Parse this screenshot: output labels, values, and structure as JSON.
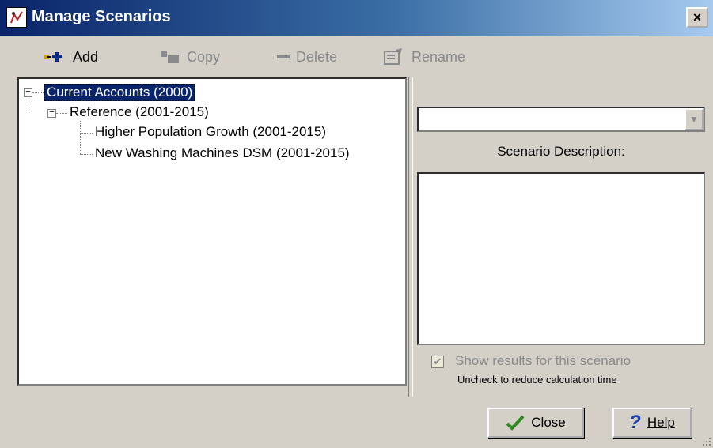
{
  "window": {
    "title": "Manage Scenarios",
    "close_glyph": "×"
  },
  "toolbar": {
    "add_label": "Add",
    "copy_label": "Copy",
    "delete_label": "Delete",
    "rename_label": "Rename"
  },
  "tree": {
    "root": "Current Accounts (2000)",
    "child": "Reference (2001-2015)",
    "grandchildren": [
      "Higher Population Growth (2001-2015)",
      "New Washing Machines DSM (2001-2015)"
    ],
    "expand_glyph": "−"
  },
  "right_panel": {
    "combo_value": "",
    "description_label": "Scenario Description:",
    "description_value": "",
    "show_results_label": "Show results for this scenario",
    "show_results_checked": true,
    "hint": "Uncheck to reduce calculation time"
  },
  "buttons": {
    "close_label": "Close",
    "help_label": "Help"
  },
  "colors": {
    "title_bar_start": "#0a246a",
    "selection": "#0a246a",
    "help_blue": "#1e3fb0",
    "close_check": "#2e8b20"
  }
}
